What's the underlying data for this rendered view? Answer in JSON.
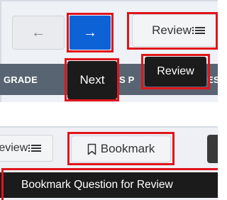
{
  "navigation": {
    "prev_icon": "arrow-left-icon",
    "next_icon": "arrow-right-icon",
    "review_label": "Review",
    "review_icon": "list-icon"
  },
  "tooltips": {
    "next": "Next",
    "review": "Review",
    "bookmark": "Bookmark Question for Review"
  },
  "header_strip": {
    "left_text": "GRADE",
    "fragment_1": "S P",
    "fragment_2": "ES"
  },
  "toolbar": {
    "review_partial_label": "Review",
    "bookmark_label": "Bookmark",
    "bookmark_icon": "bookmark-icon"
  },
  "colors": {
    "highlight": "#e0151b",
    "accent": "#0d62d6",
    "tooltip_bg": "#1b1b1b",
    "strip_bg": "#596472"
  }
}
